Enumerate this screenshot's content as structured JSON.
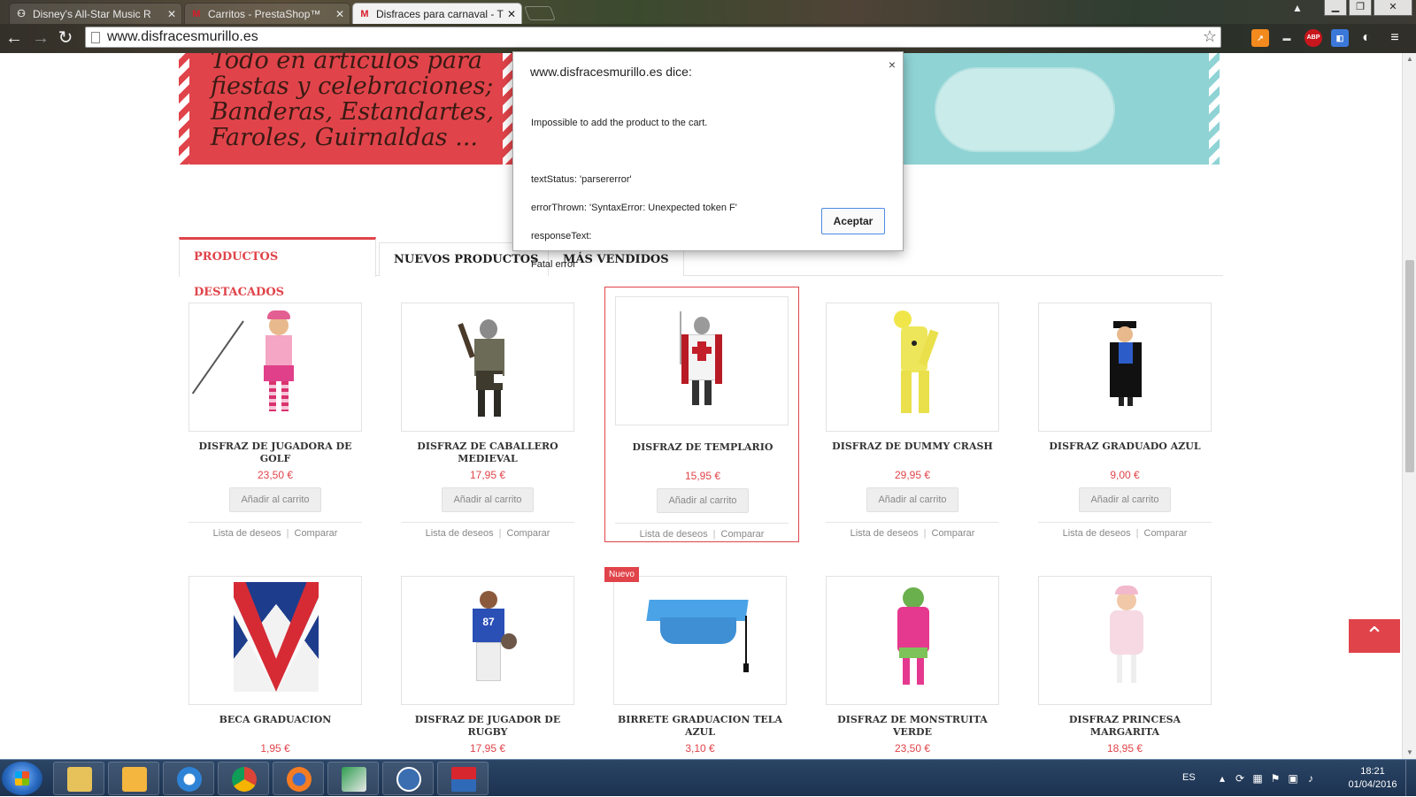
{
  "browser": {
    "tabs": [
      {
        "title": "Disney's All-Star Music R",
        "icon": "binoculars-icon"
      },
      {
        "title": "Carritos - PrestaShop™",
        "icon": "prestashop-icon"
      },
      {
        "title": "Disfraces para carnaval - T",
        "icon": "prestashop-icon",
        "active": true
      }
    ],
    "window_buttons": {
      "minimize": "▁",
      "restore": "❐",
      "close": "✕"
    },
    "url": "www.disfracesmurillo.es",
    "nav": {
      "back": "←",
      "forward": "→",
      "reload": "↻"
    },
    "extensions": [
      {
        "name": "trend-icon",
        "label": "↗",
        "color": "#f28a1e"
      },
      {
        "name": "menu-lines-icon",
        "label": "▬",
        "color": "#4a4a4a"
      },
      {
        "name": "adblock-icon",
        "label": "ABP",
        "color": "#c8161d"
      },
      {
        "name": "cast-icon",
        "label": "◧",
        "color": "#3b78d8"
      },
      {
        "name": "circle-icon",
        "label": "◐",
        "color": "#333333"
      }
    ]
  },
  "banner": {
    "lines": [
      "Todo en artículos para",
      "fiestas y celebraciones;",
      "Banderas, Estandartes,",
      "Faroles, Guirnaldas ..."
    ]
  },
  "product_tabs": [
    "PRODUCTOS DESTACADOS",
    "NUEVOS PRODUCTOS",
    "MÁS VENDIDOS"
  ],
  "product_tabs_active": "PRODUCTOS DESTACADOS",
  "card_actions": {
    "add_to_cart": "Añadir al carrito",
    "wishlist": "Lista de deseos",
    "compare": "Comparar",
    "separator": "|"
  },
  "products_row1": [
    {
      "name": "DISFRAZ DE JUGADORA DE GOLF",
      "price": "23,50 €"
    },
    {
      "name": "DISFRAZ DE CABALLERO MEDIEVAL",
      "price": "17,95 €"
    },
    {
      "name": "DISFRAZ DE TEMPLARIO",
      "price": "15,95 €"
    },
    {
      "name": "DISFRAZ DE DUMMY CRASH",
      "price": "29,95 €"
    },
    {
      "name": "DISFRAZ GRADUADO AZUL",
      "price": "9,00 €"
    }
  ],
  "products_row2": [
    {
      "name": "BECA GRADUACION",
      "price": "1,95 €"
    },
    {
      "name": "DISFRAZ DE JUGADOR DE RUGBY",
      "price": "17,95 €"
    },
    {
      "name": "BIRRETE GRADUACION TELA AZUL",
      "price": "3,10 €",
      "badge": "Nuevo"
    },
    {
      "name": "DISFRAZ DE MONSTRUITA VERDE",
      "price": "23,50 €"
    },
    {
      "name": "DISFRAZ PRINCESA MARGARITA",
      "price": "18,95 €"
    }
  ],
  "back_to_top": "⌃",
  "dialog": {
    "title": "www.disfracesmurillo.es dice:",
    "close": "×",
    "message_lines": [
      "Impossible to add the product to the cart.",
      "",
      "textStatus: 'parsererror'",
      "errorThrown: 'SyntaxError: Unexpected token F'",
      "responseText:",
      "Fatal error"
    ],
    "ok_button": "Aceptar"
  },
  "taskbar": {
    "apps": [
      "explorer",
      "outlook",
      "internet-explorer",
      "chrome",
      "firefox",
      "sql-app",
      "gc-app",
      "seur-app"
    ],
    "language": "ES",
    "time": "18:21",
    "date": "01/04/2016"
  },
  "colors": {
    "accent": "#e0444a",
    "banner_blue": "#8fd3d5"
  }
}
